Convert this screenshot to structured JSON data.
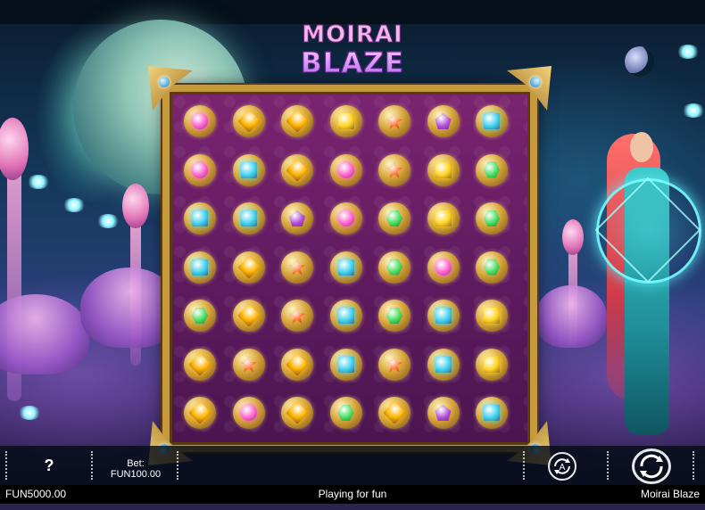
{
  "game": {
    "logo_line1": "MOIRAI",
    "logo_line2": "BLAZE"
  },
  "controls": {
    "help_label": "?",
    "bet_label": "Bet:",
    "bet_value": "FUN100.00",
    "auto_label": "A"
  },
  "status": {
    "balance": "FUN5000.00",
    "mode": "Playing for fun",
    "game_name": "Moirai Blaze"
  },
  "symbol_styles": {
    "pink": {
      "shape": "circle",
      "color": "#ff5fd0"
    },
    "amber": {
      "shape": "diamond",
      "color": "#ffb400"
    },
    "yellow": {
      "shape": "square",
      "color": "#ffd21e"
    },
    "orange": {
      "shape": "star",
      "color": "#ff6a2a"
    },
    "purple": {
      "shape": "pent",
      "color": "#b04ad8"
    },
    "cyan": {
      "shape": "square",
      "color": "#3fd2f0"
    },
    "green": {
      "shape": "hex",
      "color": "#3fdc5a"
    }
  },
  "board": {
    "rows": 7,
    "cols": 7,
    "grid": [
      [
        "pink",
        "amber",
        "amber",
        "yellow",
        "orange",
        "purple",
        "cyan"
      ],
      [
        "pink",
        "cyan",
        "amber",
        "pink",
        "orange",
        "yellow",
        "green"
      ],
      [
        "cyan",
        "cyan",
        "purple",
        "pink",
        "green",
        "yellow",
        "green"
      ],
      [
        "cyan",
        "amber",
        "orange",
        "cyan",
        "green",
        "pink",
        "green"
      ],
      [
        "green",
        "amber",
        "orange",
        "cyan",
        "green",
        "cyan",
        "yellow"
      ],
      [
        "amber",
        "orange",
        "amber",
        "cyan",
        "orange",
        "cyan",
        "yellow"
      ],
      [
        "amber",
        "pink",
        "amber",
        "green",
        "amber",
        "purple",
        "cyan"
      ]
    ]
  }
}
